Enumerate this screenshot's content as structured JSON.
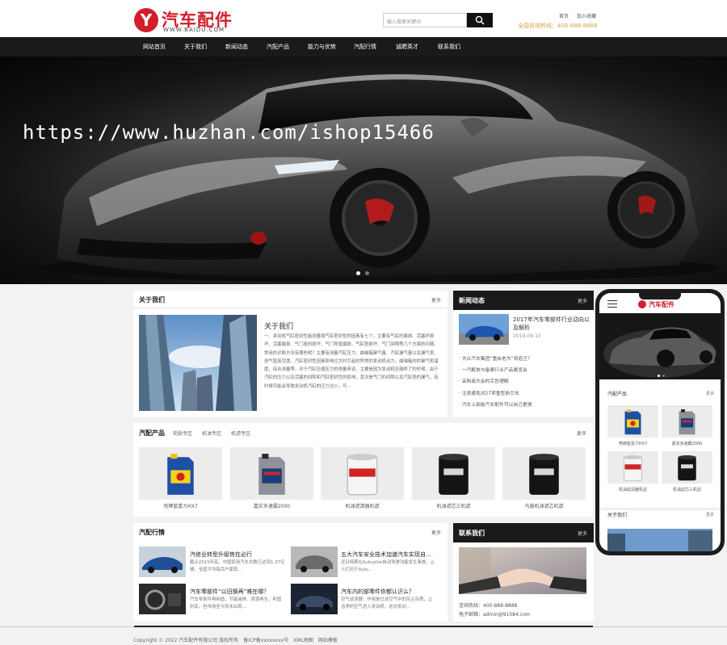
{
  "header": {
    "logo_mark": "Y",
    "logo_name": "汽车配件",
    "logo_url": "WWW.BAIDU.COM",
    "search_placeholder": "输入搜索关键词",
    "links": [
      "首页",
      "加入收藏"
    ],
    "hotline": "全国咨询热线：400-888-8888"
  },
  "nav": [
    "网站首页",
    "关于我们",
    "新闻动态",
    "汽配产品",
    "能力与优势",
    "汽配行情",
    "诚聘英才",
    "联系我们"
  ],
  "banner": {
    "watermark": "https://www.huzhan.com/ishop15466"
  },
  "about": {
    "title": "关于我们",
    "more": "更多",
    "heading": "关于我们",
    "text": "一、发动机气缸密封性能测量填气缸密封性的因素有七个，主要有气缸的磨损、活塞环损坏、活塞磨损、气门座的损坏，气门导管磨损、气缸垫损坏、气门间隙等几个方面的问题。常用的诊断方法有哪些呢？主要有测量汽缸压力、曲轴箱窜气量、汽缸漏气量以及漏气率、进气管真空度。汽缸密封性因素影响过大时引起的异常的发动机动力，曲轴箱内的窜气和温度，综合测量等，对于汽缸压缩压力的测量来说，主要是因为发动机压缩终了的时候，由于汽缸的压力以及活塞的间隙和汽缸密封性的影响，其次是气门的间隙以及汽缸垫的漏气，有时候可能会导致发动机汽缸的压力过小，可···"
  },
  "news": {
    "title": "新闻动态",
    "more": "更多",
    "featured_title": "2017年汽车零部件行业动向以及解析",
    "featured_date": "2019-09-10",
    "items": [
      "大众汽车集团“重启老大”将若王？",
      "一汽解放与备案行业产品展览会",
      "采购商大会的宗旨理解",
      "注意避免对27项重型新引车",
      "汽车上部能汽车配件可以自己更换"
    ]
  },
  "products": {
    "title": "汽配产品",
    "more": "更多",
    "tabs": [
      "轮胎专区",
      "机油专区",
      "机滤专区"
    ],
    "items": [
      {
        "name": "壳牌蓝喜力HX7",
        "type": "oil-blue"
      },
      {
        "name": "嘉实多速霸2000",
        "type": "oil-gray"
      },
      {
        "name": "机油滤清器机滤",
        "type": "filter-white"
      },
      {
        "name": "机油滤芯三机滤",
        "type": "filter-black"
      },
      {
        "name": "马勒机油滤芯机滤",
        "type": "filter-black"
      }
    ]
  },
  "industry": {
    "title": "汽配行情",
    "more": "更多",
    "items": [
      {
        "title": "汽修业转型升级势在必行",
        "text": "截止2015年底，中国民用汽车总数已达到1.37亿辆，全国平均每百户家庭..."
      },
      {
        "title": "五大汽车安全技术加速汽车实现自...",
        "text": "近日特斯拉Autopilot自动驾驶功能发生事故，让人们对于Auto..."
      },
      {
        "title": "汽车零部件“以旧换再”难在哪？",
        "text": "汽车零部件再制造，节能减排、资源再生，利国利民。但市场至今尚未出现..."
      },
      {
        "title": "汽车内的部零件你都认识么？",
        "text": "空气滤清器：作用是过滤空气中的灰尘杂质，让洁净的空气进入发动机，这对发动..."
      }
    ]
  },
  "contact": {
    "title": "联系我们",
    "more": "更多",
    "phone": "咨询热线：400-888-8888",
    "email": "电子邮箱：admin@91084.com"
  },
  "mobile": {
    "logo_name": "汽车配件",
    "products_title": "汽配产品",
    "more": "更多",
    "product_names": [
      "壳牌蓝喜力HX7",
      "嘉实多速霸2000",
      "机油滤清器机滤",
      "机油滤芯三机滤"
    ],
    "about_title": "关于我们"
  },
  "footer": {
    "text": "Copyright © 2022 汽车配件有限公司 版权所有　备ICP备xxxxxxxx号　XML地图　网站模板"
  },
  "colors": {
    "brand_red": "#d21e2b",
    "dark": "#1a1a1a",
    "hotline_gold": "#d9a14b"
  }
}
